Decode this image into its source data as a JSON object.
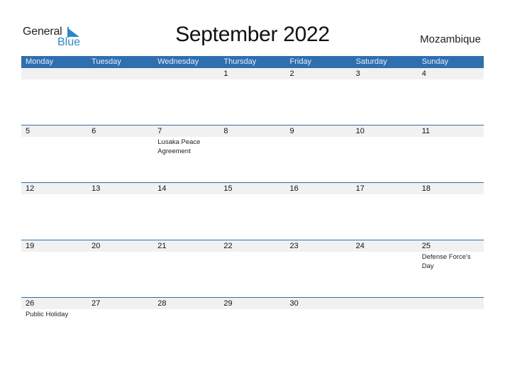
{
  "logo": {
    "text_general": "General",
    "text_blue": "Blue",
    "icon": "triangle-flag-icon"
  },
  "title": "September 2022",
  "country": "Mozambique",
  "colors": {
    "accent": "#2e6fb0",
    "logo_blue": "#2f86c6",
    "date_row_bg": "#f1f1f1"
  },
  "weekdays": [
    "Monday",
    "Tuesday",
    "Wednesday",
    "Thursday",
    "Friday",
    "Saturday",
    "Sunday"
  ],
  "weeks": [
    {
      "days": [
        {
          "num": "",
          "event": ""
        },
        {
          "num": "",
          "event": ""
        },
        {
          "num": "",
          "event": ""
        },
        {
          "num": "1",
          "event": ""
        },
        {
          "num": "2",
          "event": ""
        },
        {
          "num": "3",
          "event": ""
        },
        {
          "num": "4",
          "event": ""
        }
      ]
    },
    {
      "days": [
        {
          "num": "5",
          "event": ""
        },
        {
          "num": "6",
          "event": ""
        },
        {
          "num": "7",
          "event": "Lusaka Peace Agreement"
        },
        {
          "num": "8",
          "event": ""
        },
        {
          "num": "9",
          "event": ""
        },
        {
          "num": "10",
          "event": ""
        },
        {
          "num": "11",
          "event": ""
        }
      ]
    },
    {
      "days": [
        {
          "num": "12",
          "event": ""
        },
        {
          "num": "13",
          "event": ""
        },
        {
          "num": "14",
          "event": ""
        },
        {
          "num": "15",
          "event": ""
        },
        {
          "num": "16",
          "event": ""
        },
        {
          "num": "17",
          "event": ""
        },
        {
          "num": "18",
          "event": ""
        }
      ]
    },
    {
      "days": [
        {
          "num": "19",
          "event": ""
        },
        {
          "num": "20",
          "event": ""
        },
        {
          "num": "21",
          "event": ""
        },
        {
          "num": "22",
          "event": ""
        },
        {
          "num": "23",
          "event": ""
        },
        {
          "num": "24",
          "event": ""
        },
        {
          "num": "25",
          "event": "Defense Force's Day"
        }
      ]
    },
    {
      "days": [
        {
          "num": "26",
          "event": "Public Holiday"
        },
        {
          "num": "27",
          "event": ""
        },
        {
          "num": "28",
          "event": ""
        },
        {
          "num": "29",
          "event": ""
        },
        {
          "num": "30",
          "event": ""
        },
        {
          "num": "",
          "event": ""
        },
        {
          "num": "",
          "event": ""
        }
      ]
    }
  ]
}
